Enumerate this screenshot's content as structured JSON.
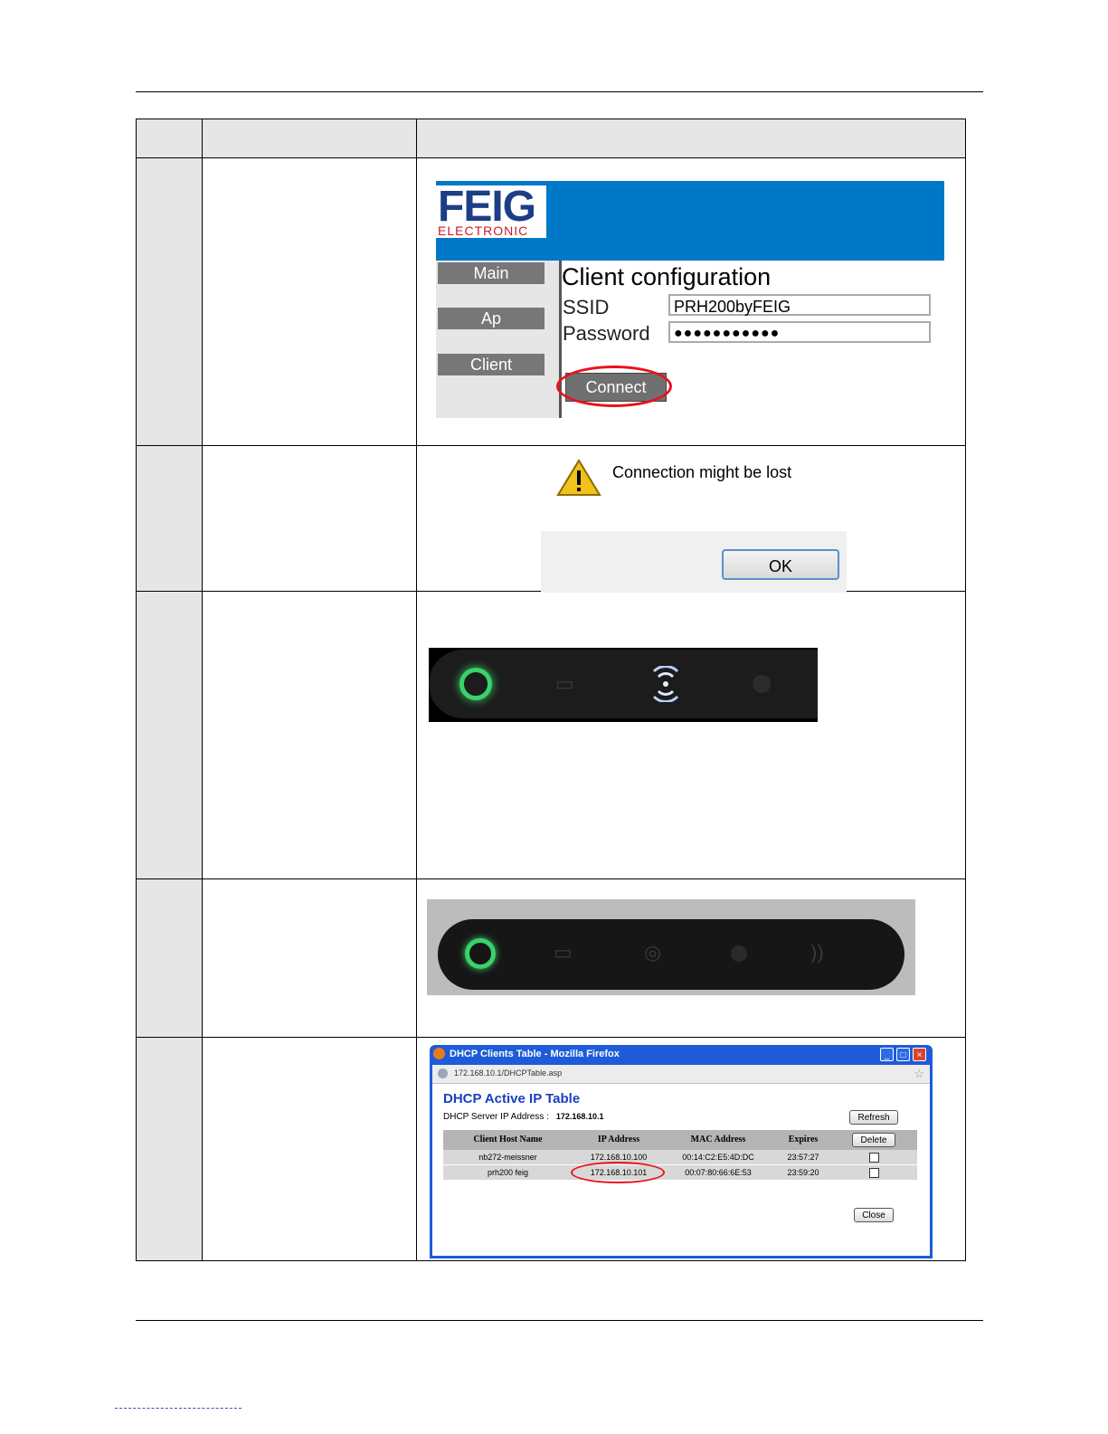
{
  "feig_config": {
    "logo_main": "FEIG",
    "logo_sub": "ELECTRONIC",
    "nav": [
      "Main",
      "Ap",
      "Client"
    ],
    "title": "Client configuration",
    "ssid_label": "SSID",
    "ssid_value": "PRH200byFEIG",
    "password_label": "Password",
    "password_value": "●●●●●●●●●●●",
    "connect_label": "Connect"
  },
  "alert": {
    "message": "Connection might be lost",
    "ok_label": "OK"
  },
  "dhcp": {
    "window_title": "DHCP Clients Table - Mozilla Firefox",
    "url": "172.168.10.1/DHCPTable.asp",
    "heading": "DHCP Active IP Table",
    "server_label": "DHCP Server IP Address :",
    "server_ip": "172.168.10.1",
    "refresh_label": "Refresh",
    "delete_label": "Delete",
    "close_label": "Close",
    "columns": [
      "Client Host Name",
      "IP Address",
      "MAC Address",
      "Expires"
    ],
    "rows": [
      {
        "host": "nb272-meissner",
        "ip": "172.168.10.100",
        "mac": "00:14:C2:E5:4D:DC",
        "expires": "23:57:27"
      },
      {
        "host": "prh200 feig",
        "ip": "172.168.10.101",
        "mac": "00:07:80:66:6E:53",
        "expires": "23:59:20"
      }
    ]
  },
  "colors": {
    "feig_blue": "#0078c8",
    "highlight_red": "#e8121c",
    "led_green": "#3bd26a",
    "led_white": "#dfeaff"
  },
  "icons": [
    "warning-icon",
    "power-led-icon",
    "battery-icon",
    "wifi-icon",
    "status-dot-icon",
    "rfid-icon",
    "firefox-icon"
  ]
}
